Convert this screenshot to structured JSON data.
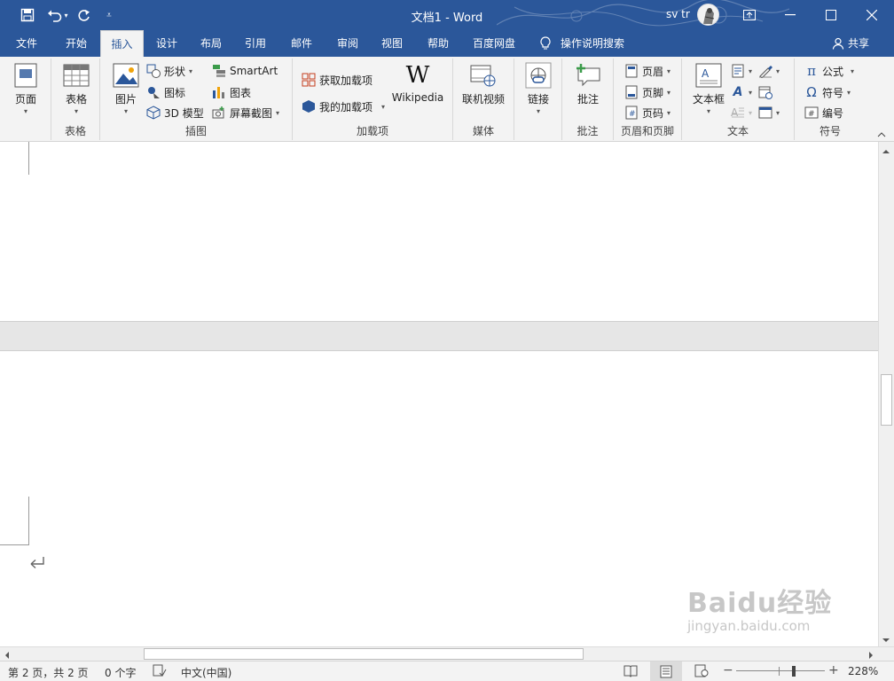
{
  "window": {
    "title": "文档1  -  Word",
    "user": "sv tr"
  },
  "menu_tabs": [
    {
      "label": "文件"
    },
    {
      "label": "开始"
    },
    {
      "label": "插入"
    },
    {
      "label": "设计"
    },
    {
      "label": "布局"
    },
    {
      "label": "引用"
    },
    {
      "label": "邮件"
    },
    {
      "label": "审阅"
    },
    {
      "label": "视图"
    },
    {
      "label": "帮助"
    },
    {
      "label": "百度网盘"
    }
  ],
  "active_tab": "插入",
  "search_label": "操作说明搜索",
  "share_label": "共享",
  "ribbon": {
    "pages": {
      "btn": "页面",
      "group": ""
    },
    "tables": {
      "btn": "表格",
      "group": "表格"
    },
    "illustrations": {
      "group": "插图",
      "picture": "图片",
      "shapes": "形状",
      "icons": "图标",
      "model3d": "3D 模型",
      "smartart": "SmartArt",
      "chart": "图表",
      "screenshot": "屏幕截图"
    },
    "addins": {
      "group": "加载项",
      "get": "获取加载项",
      "my": "我的加载项",
      "wikipedia": "Wikipedia"
    },
    "media": {
      "group": "媒体",
      "online_video": "联机视频"
    },
    "links": {
      "btn": "链接"
    },
    "comments": {
      "group": "批注",
      "btn": "批注"
    },
    "header_footer": {
      "group": "页眉和页脚",
      "header": "页眉",
      "footer": "页脚",
      "page_number": "页码"
    },
    "text": {
      "group": "文本",
      "textbox": "文本框"
    },
    "symbols": {
      "group": "符号",
      "equation": "公式",
      "symbol": "符号",
      "number": "编号"
    }
  },
  "status": {
    "page": "第 2 页，共 2 页",
    "words": "0 个字",
    "language": "中文(中国)",
    "zoom": "228%"
  },
  "watermark": {
    "brand": "Baidu经验",
    "url": "jingyan.baidu.com"
  },
  "colors": {
    "accent": "#2b579a",
    "ribbon_bg": "#f3f3f3",
    "gap": "#e6e6e6"
  }
}
